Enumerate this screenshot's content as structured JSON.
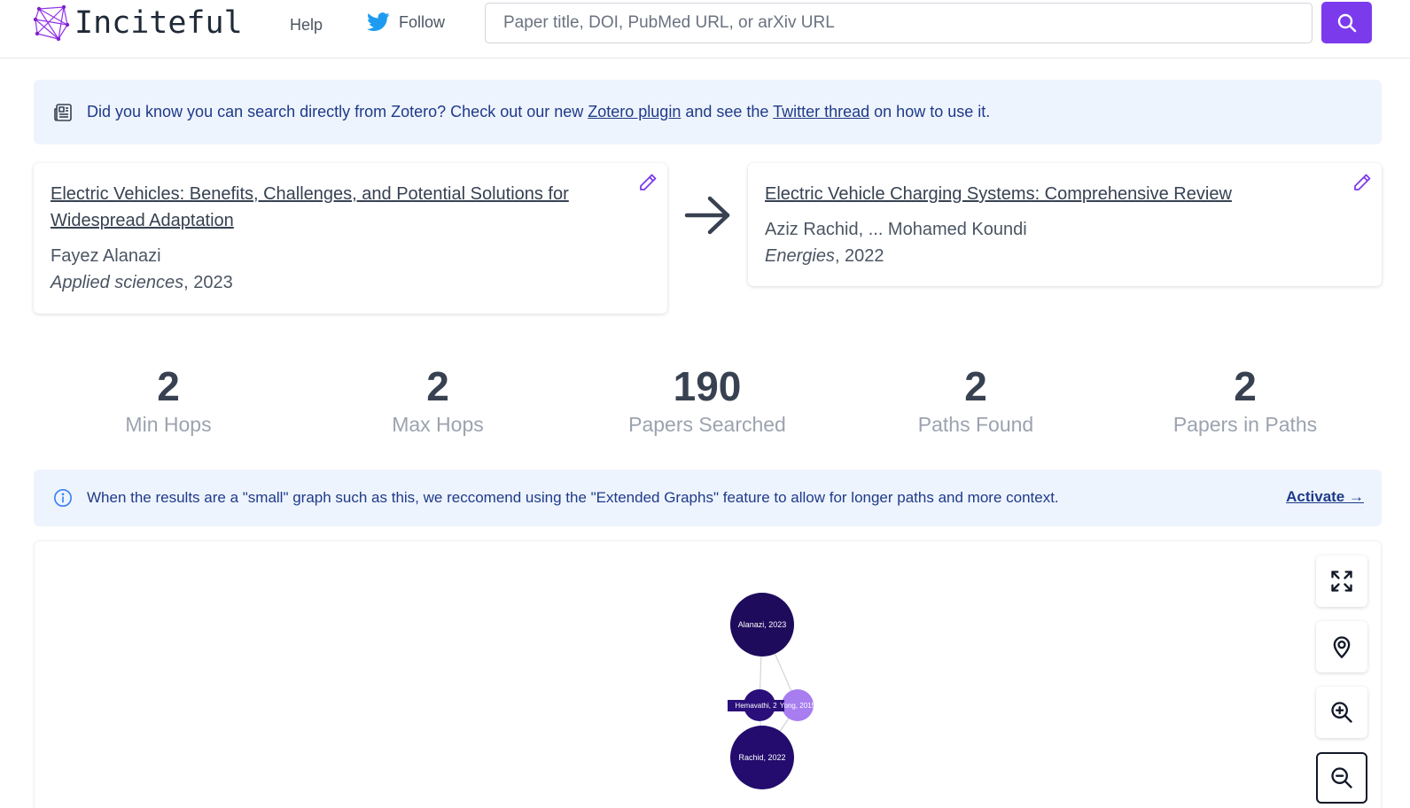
{
  "header": {
    "logo_text": "Inciteful",
    "help_label": "Help",
    "follow_label": "Follow",
    "search_placeholder": "Paper title, DOI, PubMed URL, or arXiv URL",
    "search_value": ""
  },
  "banner": {
    "text_before": "Did you know you can search directly from Zotero? Check out our new ",
    "link1": "Zotero plugin",
    "text_middle": " and see the ",
    "link2": "Twitter thread",
    "text_after": " on how to use it."
  },
  "source_paper": {
    "title": "Electric Vehicles: Benefits, Challenges, and Potential Solutions for Widespread Adaptation",
    "authors": "Fayez Alanazi",
    "venue": "Applied sciences",
    "year": ", 2023"
  },
  "target_paper": {
    "title": "Electric Vehicle Charging Systems: Comprehensive Review",
    "authors": "Aziz Rachid, ... Mohamed Koundi",
    "venue": "Energies",
    "year": ", 2022"
  },
  "stats": [
    {
      "value": "2",
      "label": "Min Hops"
    },
    {
      "value": "2",
      "label": "Max Hops"
    },
    {
      "value": "190",
      "label": "Papers Searched"
    },
    {
      "value": "2",
      "label": "Paths Found"
    },
    {
      "value": "2",
      "label": "Papers in Paths"
    }
  ],
  "info": {
    "text": "When the results are a \"small\" graph such as this, we reccomend using the \"Extended Graphs\" feature to allow for longer paths and more context.",
    "link": "Activate →"
  },
  "graph": {
    "nodes": [
      {
        "label": "Alanazi, 2023",
        "color": "#1e0b5c"
      },
      {
        "label": "Hemavathi, 2",
        "color": "#2a0f7a"
      },
      {
        "label": "Yong, 2015",
        "color": "#a77df0"
      },
      {
        "label": "Rachid, 2022",
        "color": "#230c6e"
      }
    ]
  },
  "colors": {
    "accent": "#7c3aed",
    "banner_bg": "#eef4fd",
    "banner_text": "#1e3a8a"
  },
  "icons": [
    "logo-icon",
    "twitter-icon",
    "search-icon",
    "newspaper-icon",
    "pencil-icon",
    "arrow-right-icon",
    "info-icon",
    "expand-icon",
    "location-pin-icon",
    "zoom-in-icon",
    "zoom-out-icon"
  ]
}
